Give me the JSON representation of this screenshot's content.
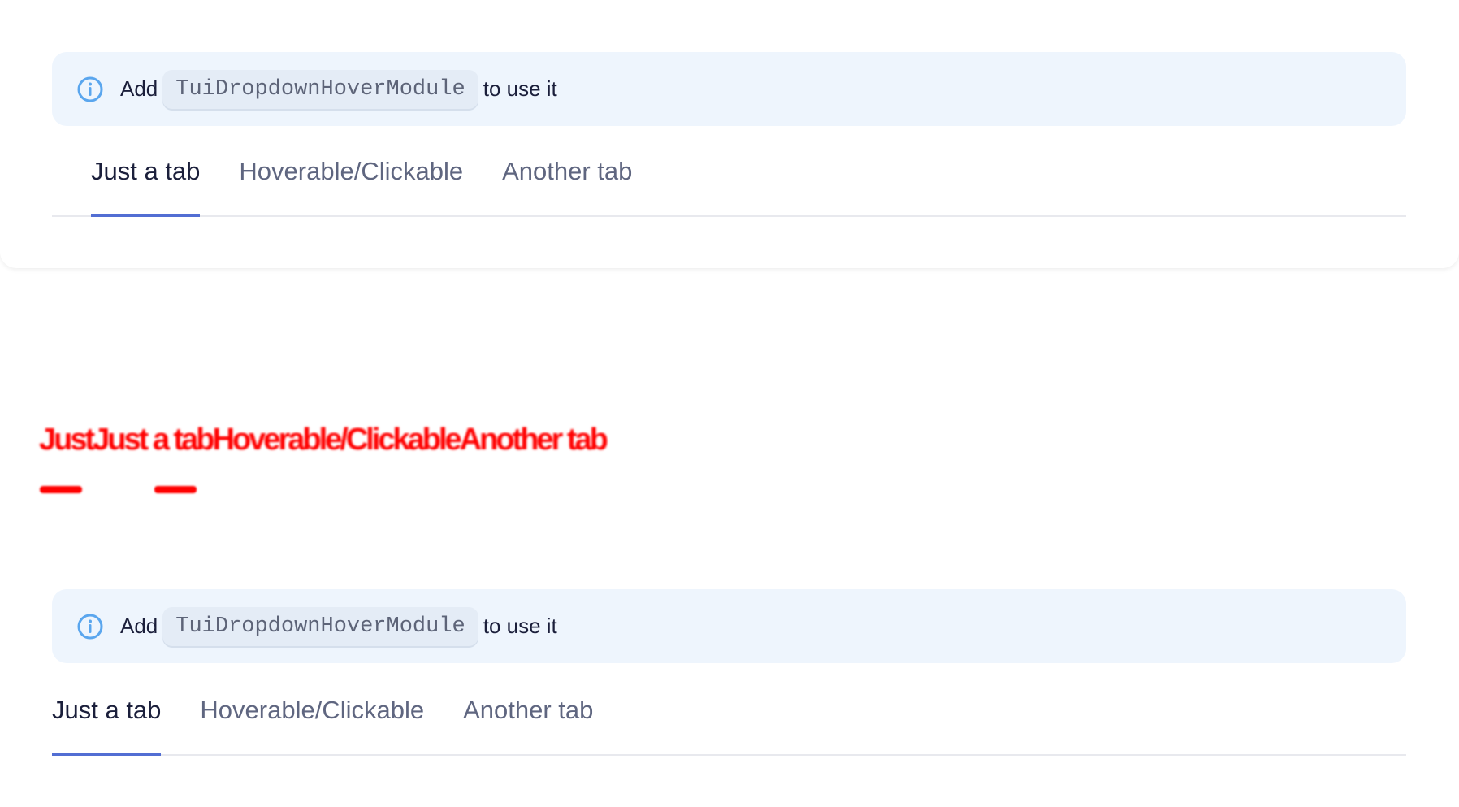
{
  "notice": {
    "prefix": "Add",
    "code": "TuiDropdownHoverModule",
    "suffix": "to use it"
  },
  "tabs": [
    {
      "label": "Just a tab",
      "active": true
    },
    {
      "label": "Hoverable/Clickable",
      "active": false
    },
    {
      "label": "Another tab",
      "active": false
    }
  ],
  "glitch_text": "JustJust a tabHoverable/ClickableAnother tab",
  "colors": {
    "notice_bg": "#eef5fd",
    "active_underline": "#526ed3",
    "glitch": "#ff0000"
  }
}
